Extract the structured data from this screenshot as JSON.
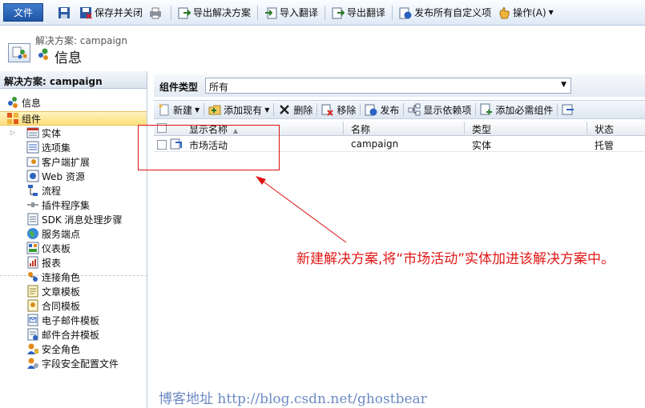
{
  "toolbar": {
    "file": "文件",
    "save_close": "保存并关闭",
    "export_solution": "导出解决方案",
    "import_translation": "导入翻译",
    "export_translation": "导出翻译",
    "publish_all": "发布所有自定义项",
    "actions": "操作(A)"
  },
  "header": {
    "subtitle": "解决方案: campaign",
    "title": "信息"
  },
  "nav": {
    "heading": "解决方案: campaign",
    "info": "信息",
    "components": "组件",
    "items": [
      "实体",
      "选项集",
      "客户端扩展",
      "Web 资源",
      "流程",
      "插件程序集",
      "SDK 消息处理步骤",
      "服务端点",
      "仪表板",
      "报表",
      "连接角色",
      "文章模板",
      "合同模板",
      "电子邮件模板",
      "邮件合并模板",
      "安全角色",
      "字段安全配置文件"
    ]
  },
  "component_type": {
    "label": "组件类型",
    "value": "所有"
  },
  "commands": {
    "new": "新建",
    "add_existing": "添加现有",
    "delete": "删除",
    "remove": "移除",
    "publish": "发布",
    "show_deps": "显示依赖项",
    "add_required": "添加必需组件"
  },
  "grid": {
    "columns": [
      "显示名称",
      "名称",
      "类型",
      "状态"
    ],
    "rows": [
      {
        "display_name": "市场活动",
        "name": "campaign",
        "type": "实体",
        "state": "托管"
      }
    ]
  },
  "annotation": "新建解决方案,将“市场活动”实体加进该解决方案中。",
  "footer": "博客地址 http://blog.csdn.net/ghostbear",
  "colors": {
    "annotation": "#e01818",
    "selected_nav": "#ffdf7a",
    "accent": "#1f55a5"
  }
}
